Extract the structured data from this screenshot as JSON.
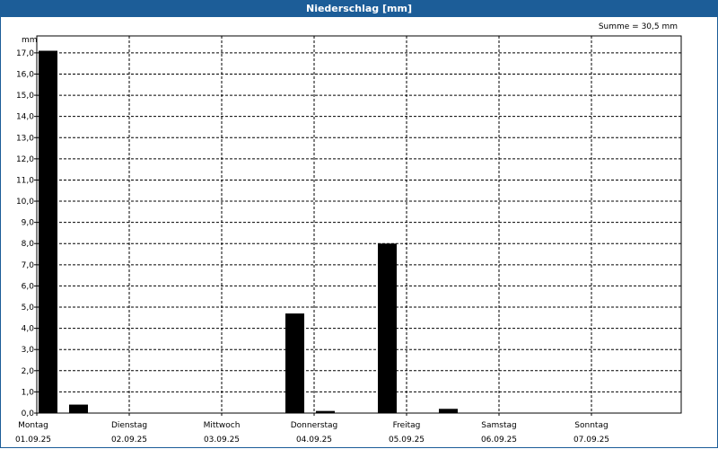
{
  "chart_data": {
    "type": "bar",
    "title": "Niederschlag [mm]",
    "ylabel": "mm",
    "sum_label": "Summe = 30,5 mm",
    "ylim": [
      0,
      17.8
    ],
    "yticks": [
      "0,0",
      "1,0",
      "2,0",
      "3,0",
      "4,0",
      "5,0",
      "6,0",
      "7,0",
      "8,0",
      "9,0",
      "10,0",
      "11,0",
      "12,0",
      "13,0",
      "14,0",
      "15,0",
      "16,0",
      "17,0"
    ],
    "days": [
      {
        "name": "Montag",
        "date": "01.09.25"
      },
      {
        "name": "Dienstag",
        "date": "02.09.25"
      },
      {
        "name": "Mittwoch",
        "date": "03.09.25"
      },
      {
        "name": "Donnerstag",
        "date": "04.09.25"
      },
      {
        "name": "Freitag",
        "date": "05.09.25"
      },
      {
        "name": "Samstag",
        "date": "06.09.25"
      },
      {
        "name": "Sonntag",
        "date": "07.09.25"
      }
    ],
    "bars": [
      {
        "day_offset": 0.0,
        "value": 17.1
      },
      {
        "day_offset": 0.33,
        "value": 0.4
      },
      {
        "day_offset": 2.67,
        "value": 4.7
      },
      {
        "day_offset": 3.0,
        "value": 0.1
      },
      {
        "day_offset": 3.67,
        "value": 8.0
      },
      {
        "day_offset": 4.33,
        "value": 0.2
      }
    ],
    "grid": true,
    "bar_color": "#000000",
    "grid_color": "#000000"
  }
}
